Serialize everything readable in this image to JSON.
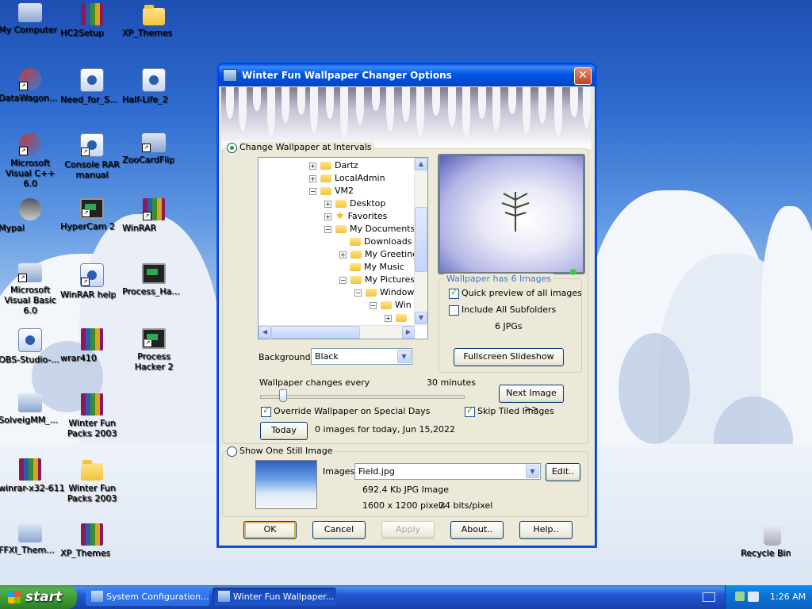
{
  "desktop": {
    "icons": [
      {
        "label": "My Computer"
      },
      {
        "label": "HC2Setup"
      },
      {
        "label": "XP_Themes"
      },
      {
        "label": "DataWagon..."
      },
      {
        "label": "Need_for_S..."
      },
      {
        "label": "Half-Life_2"
      },
      {
        "label": "Microsoft Visual C++ 6.0"
      },
      {
        "label": "Console RAR manual"
      },
      {
        "label": "ZooCardFlip"
      },
      {
        "label": "Mypal"
      },
      {
        "label": "HyperCam 2"
      },
      {
        "label": "WinRAR"
      },
      {
        "label": "Microsoft Visual Basic 6.0"
      },
      {
        "label": "WinRAR help"
      },
      {
        "label": "Process_Ha..."
      },
      {
        "label": "OBS-Studio-..."
      },
      {
        "label": "wrar410"
      },
      {
        "label": "Process Hacker 2"
      },
      {
        "label": "SolveigMM_..."
      },
      {
        "label": "Winter Fun Packs 2003"
      },
      {
        "label": "winrar-x32-611"
      },
      {
        "label": "Winter Fun Packs 2003"
      },
      {
        "label": "FFXI_Them..."
      },
      {
        "label": "XP_Themes"
      },
      {
        "label": "Recycle Bin"
      }
    ]
  },
  "window": {
    "title": "Winter Fun Wallpaper Changer Options",
    "interval_radio": "Change Wallpaper at Intervals",
    "tree": [
      {
        "label": "Dartz",
        "expander": "+"
      },
      {
        "label": "LocalAdmin",
        "expander": "+"
      },
      {
        "label": "VM2",
        "expander": "−"
      },
      {
        "label": "Desktop",
        "expander": "+"
      },
      {
        "label": "Favorites",
        "expander": "+"
      },
      {
        "label": "My Documents",
        "expander": "−"
      },
      {
        "label": "Downloads",
        "expander": ""
      },
      {
        "label": "My Greetings",
        "expander": "+"
      },
      {
        "label": "My Music",
        "expander": ""
      },
      {
        "label": "My Pictures",
        "expander": "−"
      },
      {
        "label": "Windows",
        "expander": "−"
      },
      {
        "label": "Win",
        "expander": "−"
      },
      {
        "label": "",
        "expander": "+"
      }
    ],
    "background_label": "Background",
    "background_value": "Black",
    "images_group_title": "Wallpaper has 6 Images",
    "quick_preview": "Quick preview of all images",
    "include_subfolders": "Include All Subfolders",
    "jpg_count": "6 JPGs",
    "fullscreen_button": "Fullscreen Slideshow",
    "changes_every_label": "Wallpaper changes every",
    "changes_every_value": "30 minutes",
    "next_image_button": "Next Image >>",
    "override_special_days": "Override Wallpaper on Special Days",
    "skip_tiled": "Skip Tiled Images",
    "today_button": "Today",
    "today_status": "0 images for today, Jun 15,2022",
    "still_radio": "Show One Still Image",
    "images_label": "Images:",
    "image_file": "Field.jpg",
    "edit_button": "Edit..",
    "file_info": "692.4 Kb  JPG Image",
    "dimensions": "1600 x 1200 pixels",
    "bits": "24 bits/pixel",
    "ok_button": "OK",
    "cancel_button": "Cancel",
    "apply_button": "Apply",
    "about_button": "About..",
    "help_button": "Help.."
  },
  "taskbar": {
    "start_label": "start",
    "tasks": [
      {
        "label": "System Configuration..."
      },
      {
        "label": "Winter Fun Wallpaper..."
      }
    ],
    "clock": "1:26 AM"
  }
}
